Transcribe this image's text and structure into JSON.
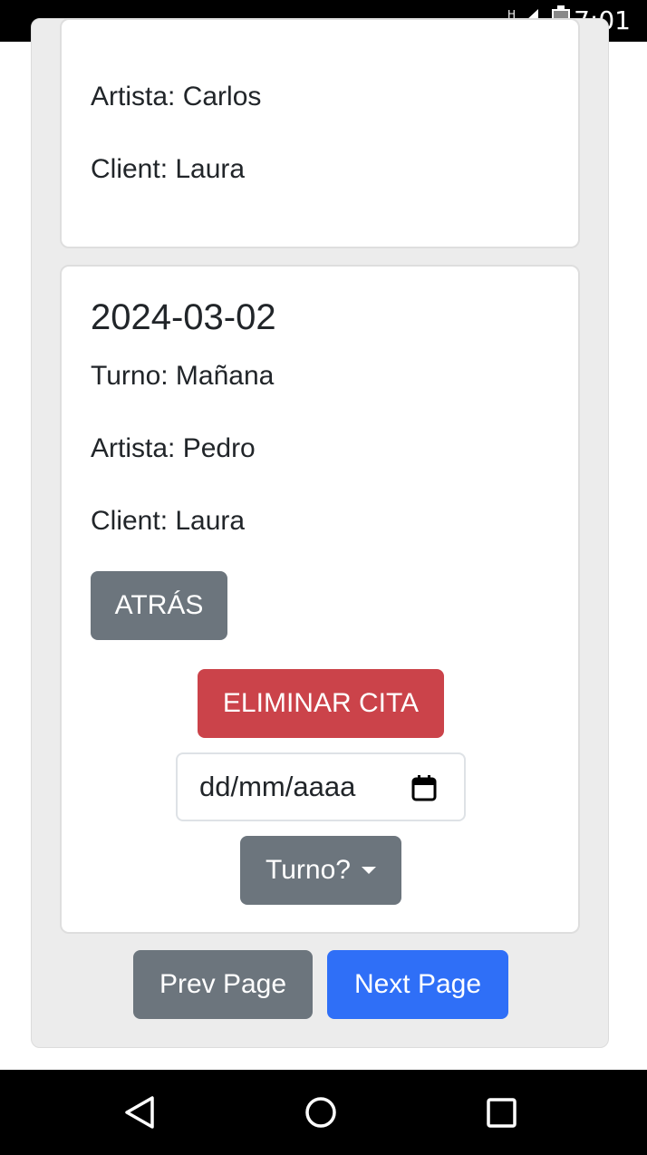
{
  "status_bar": {
    "time": "7:01",
    "network_label": "H",
    "icons": [
      "signal-icon",
      "battery-icon"
    ]
  },
  "card_previous": {
    "artist": "Artista: Carlos",
    "client": "Client: Laura"
  },
  "card_current": {
    "date": "2024-03-02",
    "shift": "Turno: Mañana",
    "artist": "Artista: Pedro",
    "client": "Client: Laura",
    "back_label": "ATRÁS",
    "delete_label": "ELIMINAR CITA",
    "date_input_placeholder": "dd/mm/aaaa",
    "shift_dropdown_label": "Turno?"
  },
  "pagination": {
    "prev_label": "Prev Page",
    "next_label": "Next Page"
  },
  "colors": {
    "secondary": "#6c757d",
    "danger": "#cb434a",
    "primary": "#2f6ff7"
  },
  "nav_bar": {
    "icons": [
      "back-icon",
      "home-icon",
      "recents-icon"
    ]
  }
}
